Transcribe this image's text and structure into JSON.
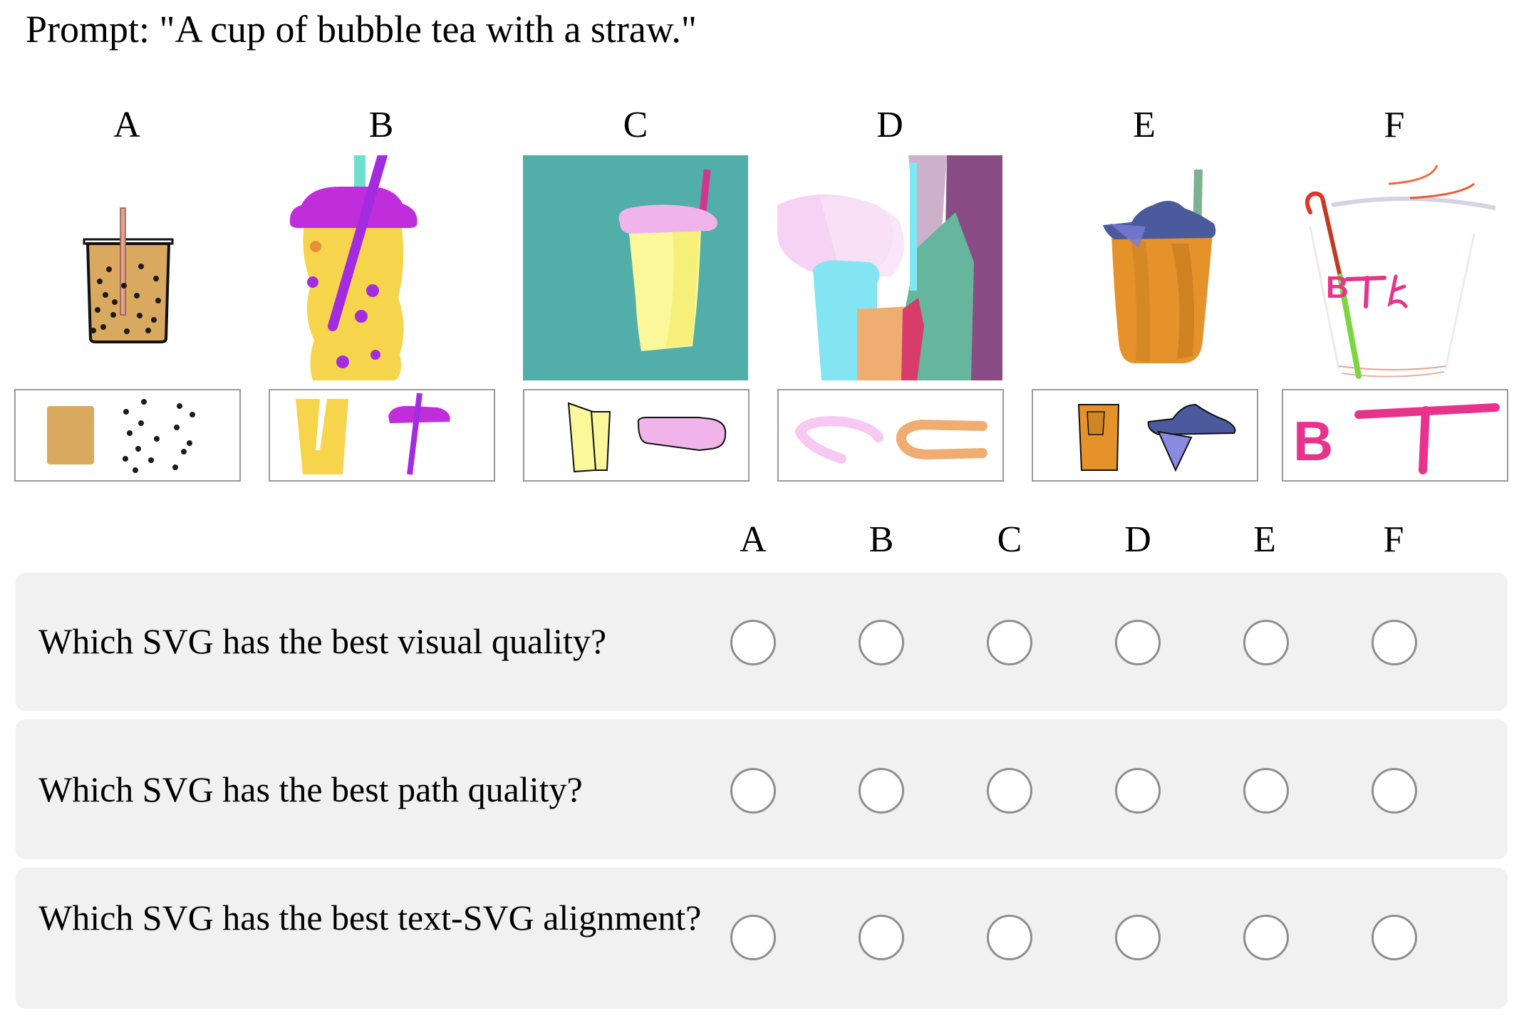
{
  "prompt": "Prompt: \"A cup of bubble tea with a straw.\"",
  "columns": [
    "A",
    "B",
    "C",
    "D",
    "E",
    "F"
  ],
  "questions": [
    {
      "text": "Which SVG has the best visual quality?"
    },
    {
      "text": "Which SVG has the best path quality?"
    },
    {
      "text": "Which SVG has the best text-SVG alignment?"
    }
  ],
  "images": {
    "F": {
      "text_lettering": "B T 人"
    }
  },
  "parts": {
    "F": {
      "text_lettering": "B T"
    }
  },
  "colors": {
    "row_background": "#f1f1f1",
    "radio_border": "#8e8e8e",
    "part_box_border": "#9a9a9a"
  }
}
